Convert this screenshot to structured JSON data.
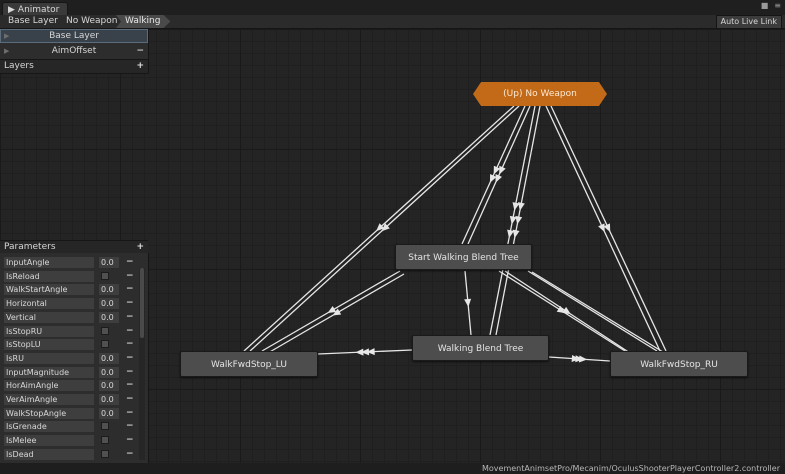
{
  "window": {
    "tab_title": "Animator"
  },
  "breadcrumbs": [
    "Base Layer",
    "No Weapon",
    "Walking"
  ],
  "toolbar": {
    "auto_live_link": "Auto Live Link"
  },
  "layers": {
    "items": [
      {
        "name": "Base Layer",
        "selected": true
      },
      {
        "name": "AimOffset",
        "selected": false
      }
    ],
    "header": "Layers"
  },
  "parameters": {
    "header": "Parameters",
    "items": [
      {
        "name": "InputAngle",
        "type": "float",
        "value": "0.0"
      },
      {
        "name": "IsReload",
        "type": "bool",
        "checked": false
      },
      {
        "name": "WalkStartAngle",
        "type": "float",
        "value": "0.0"
      },
      {
        "name": "Horizontal",
        "type": "float",
        "value": "0.0"
      },
      {
        "name": "Vertical",
        "type": "float",
        "value": "0.0"
      },
      {
        "name": "IsStopRU",
        "type": "bool",
        "checked": false
      },
      {
        "name": "IsStopLU",
        "type": "bool",
        "checked": false
      },
      {
        "name": "IsRU",
        "type": "float",
        "value": "0.0"
      },
      {
        "name": "InputMagnitude",
        "type": "float",
        "value": "0.0"
      },
      {
        "name": "HorAimAngle",
        "type": "float",
        "value": "0.0"
      },
      {
        "name": "VerAimAngle",
        "type": "float",
        "value": "0.0"
      },
      {
        "name": "WalkStopAngle",
        "type": "float",
        "value": "0.0"
      },
      {
        "name": "IsGrenade",
        "type": "bool",
        "checked": false
      },
      {
        "name": "IsMelee",
        "type": "bool",
        "checked": false
      },
      {
        "name": "IsDead",
        "type": "bool",
        "checked": false
      }
    ]
  },
  "graph": {
    "entry_node": "(Up) No Weapon",
    "nodes": {
      "start_walking": "Start Walking Blend Tree",
      "walking": "Walking Blend Tree",
      "stop_lu": "WalkFwdStop_LU",
      "stop_ru": "WalkFwdStop_RU"
    }
  },
  "status": {
    "path": "MovementAnimsetPro/Mecanim/OculusShooterPlayerController2.controller"
  },
  "colors": {
    "entry_node": "#c26a18",
    "state_node": "#4d4d4d",
    "transition": "#e6e6e6",
    "selection": "#5b6d7c"
  }
}
